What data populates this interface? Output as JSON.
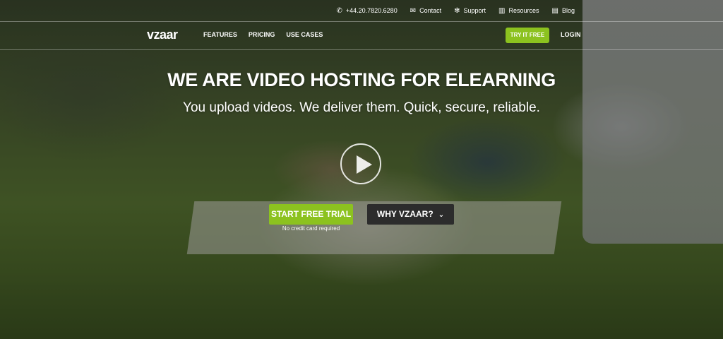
{
  "topbar": {
    "phone": {
      "icon": "phone-icon",
      "glyph": "✆",
      "label": "+44.20.7820.6280"
    },
    "contact": {
      "icon": "mail-icon",
      "glyph": "✉",
      "label": "Contact"
    },
    "support": {
      "icon": "lifebuoy-icon",
      "glyph": "✻",
      "label": "Support"
    },
    "resources": {
      "icon": "book-icon",
      "glyph": "▥",
      "label": "Resources"
    },
    "blog": {
      "icon": "blog-icon",
      "glyph": "▤",
      "label": "Blog"
    }
  },
  "nav": {
    "logo": "vzaar",
    "items": [
      "FEATURES",
      "PRICING",
      "USE CASES"
    ],
    "try_label": "TRY IT FREE",
    "login_label": "LOGIN"
  },
  "hero": {
    "headline": "WE ARE VIDEO HOSTING FOR ELEARNING",
    "subline": "You upload videos. We deliver them. Quick, secure, reliable.",
    "play_icon": "play-icon",
    "primary_label": "START FREE TRIAL",
    "primary_note": "No credit card required",
    "secondary_label": "WHY VZAAR?",
    "secondary_chevron": "⌄"
  },
  "colors": {
    "accent": "#8cc21f",
    "dark_button": "#2c2c2c"
  }
}
